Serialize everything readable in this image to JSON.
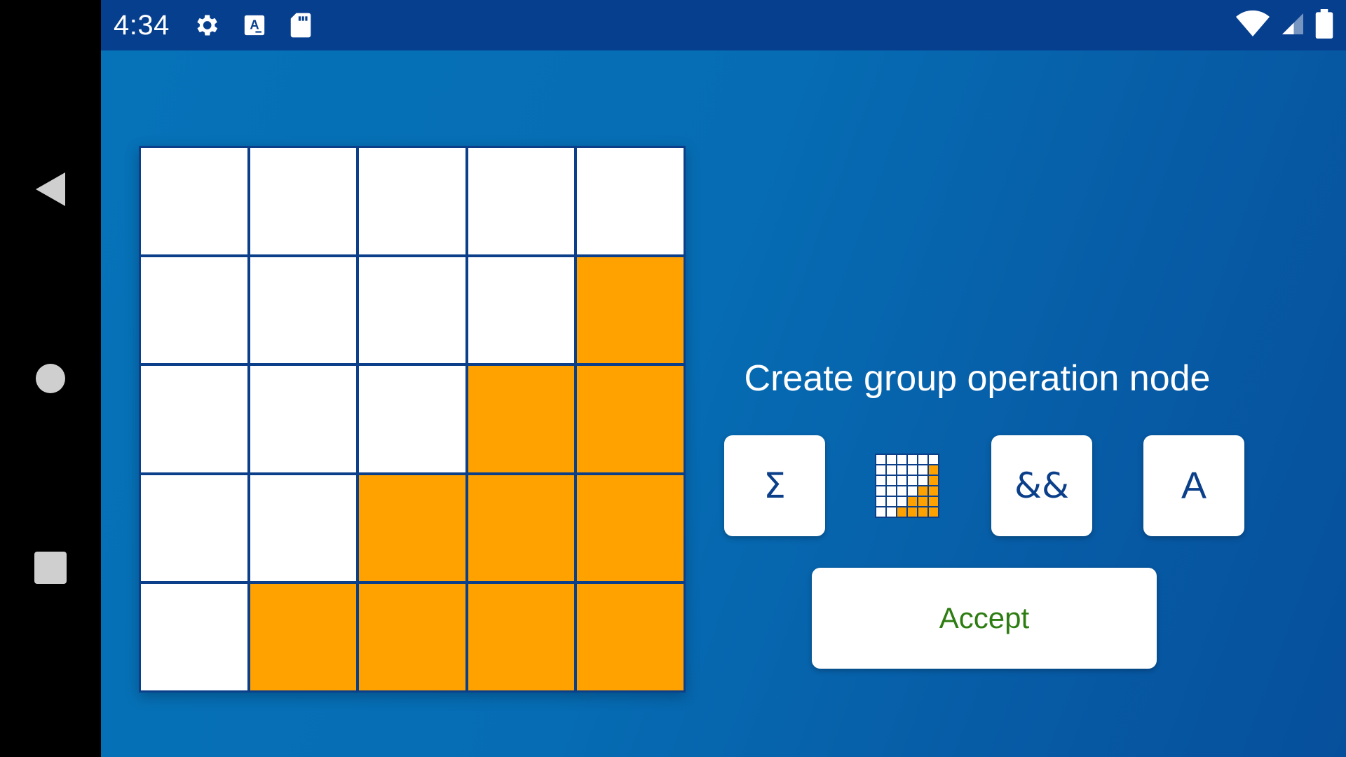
{
  "status_bar": {
    "time": "4:34",
    "left_icons": [
      "gear-icon",
      "font-a-icon",
      "sd-card-icon"
    ],
    "right_icons": [
      "wifi-icon",
      "cell-signal-icon",
      "battery-icon"
    ]
  },
  "nav_bar": {
    "buttons": [
      "back-icon",
      "home-icon",
      "recents-icon"
    ]
  },
  "board": {
    "rows": 5,
    "cols": 5,
    "cells": [
      [
        0,
        0,
        0,
        0,
        0
      ],
      [
        0,
        0,
        0,
        0,
        1
      ],
      [
        0,
        0,
        0,
        1,
        1
      ],
      [
        0,
        0,
        1,
        1,
        1
      ],
      [
        0,
        1,
        1,
        1,
        1
      ]
    ],
    "colors": {
      "on": "#ffa200",
      "off": "#ffffff",
      "border": "#0b3f8a"
    }
  },
  "dialog": {
    "title": "Create group operation node",
    "operations": {
      "sum_label": "Σ",
      "logic_label": "&&",
      "text_label": "A",
      "grid_icon": "grid-pattern-icon"
    },
    "accept_label": "Accept"
  },
  "colors": {
    "status_bar": "#073f8f",
    "background": "#066db4",
    "accept_text": "#2e7d12",
    "button_text": "#0b3f8a"
  }
}
